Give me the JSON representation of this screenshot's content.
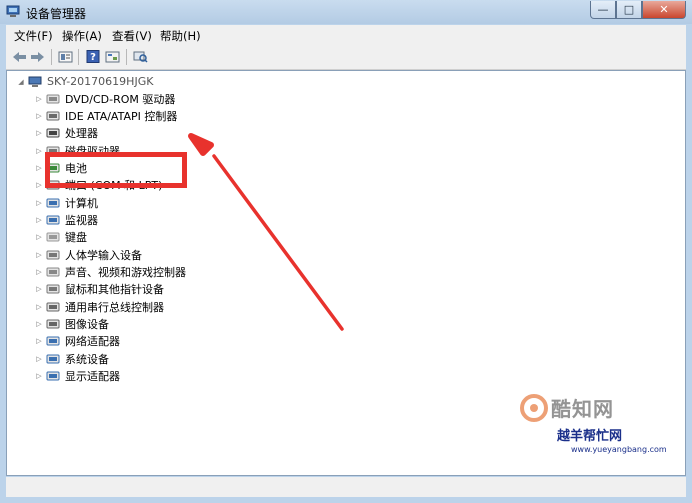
{
  "window": {
    "title": "设备管理器",
    "controls": {
      "minimize": "—",
      "maximize": "□",
      "close": "✕"
    }
  },
  "menu": [
    "文件(F)",
    "操作(A)",
    "查看(V)",
    "帮助(H)"
  ],
  "toolbar": {
    "icons": [
      "back-arrow-icon",
      "forward-arrow-icon",
      "properties-icon",
      "help-icon",
      "view-icon",
      "scan-hardware-icon"
    ]
  },
  "tree": {
    "root": "SKY-20170619HJGK",
    "items": [
      "DVD/CD-ROM 驱动器",
      "IDE ATA/ATAPI 控制器",
      "处理器",
      "磁盘驱动器",
      "电池",
      "端口 (COM 和 LPT)",
      "计算机",
      "监视器",
      "键盘",
      "人体学输入设备",
      "声音、视频和游戏控制器",
      "鼠标和其他指针设备",
      "通用串行总线控制器",
      "图像设备",
      "网络适配器",
      "系统设备",
      "显示适配器"
    ]
  },
  "watermark": {
    "text1": "酷知网",
    "text2": "越羊帮忙网",
    "url": "www.yueyangbang.com"
  },
  "colors": {
    "highlight": "#e8322d",
    "arrow": "#e8322d"
  }
}
